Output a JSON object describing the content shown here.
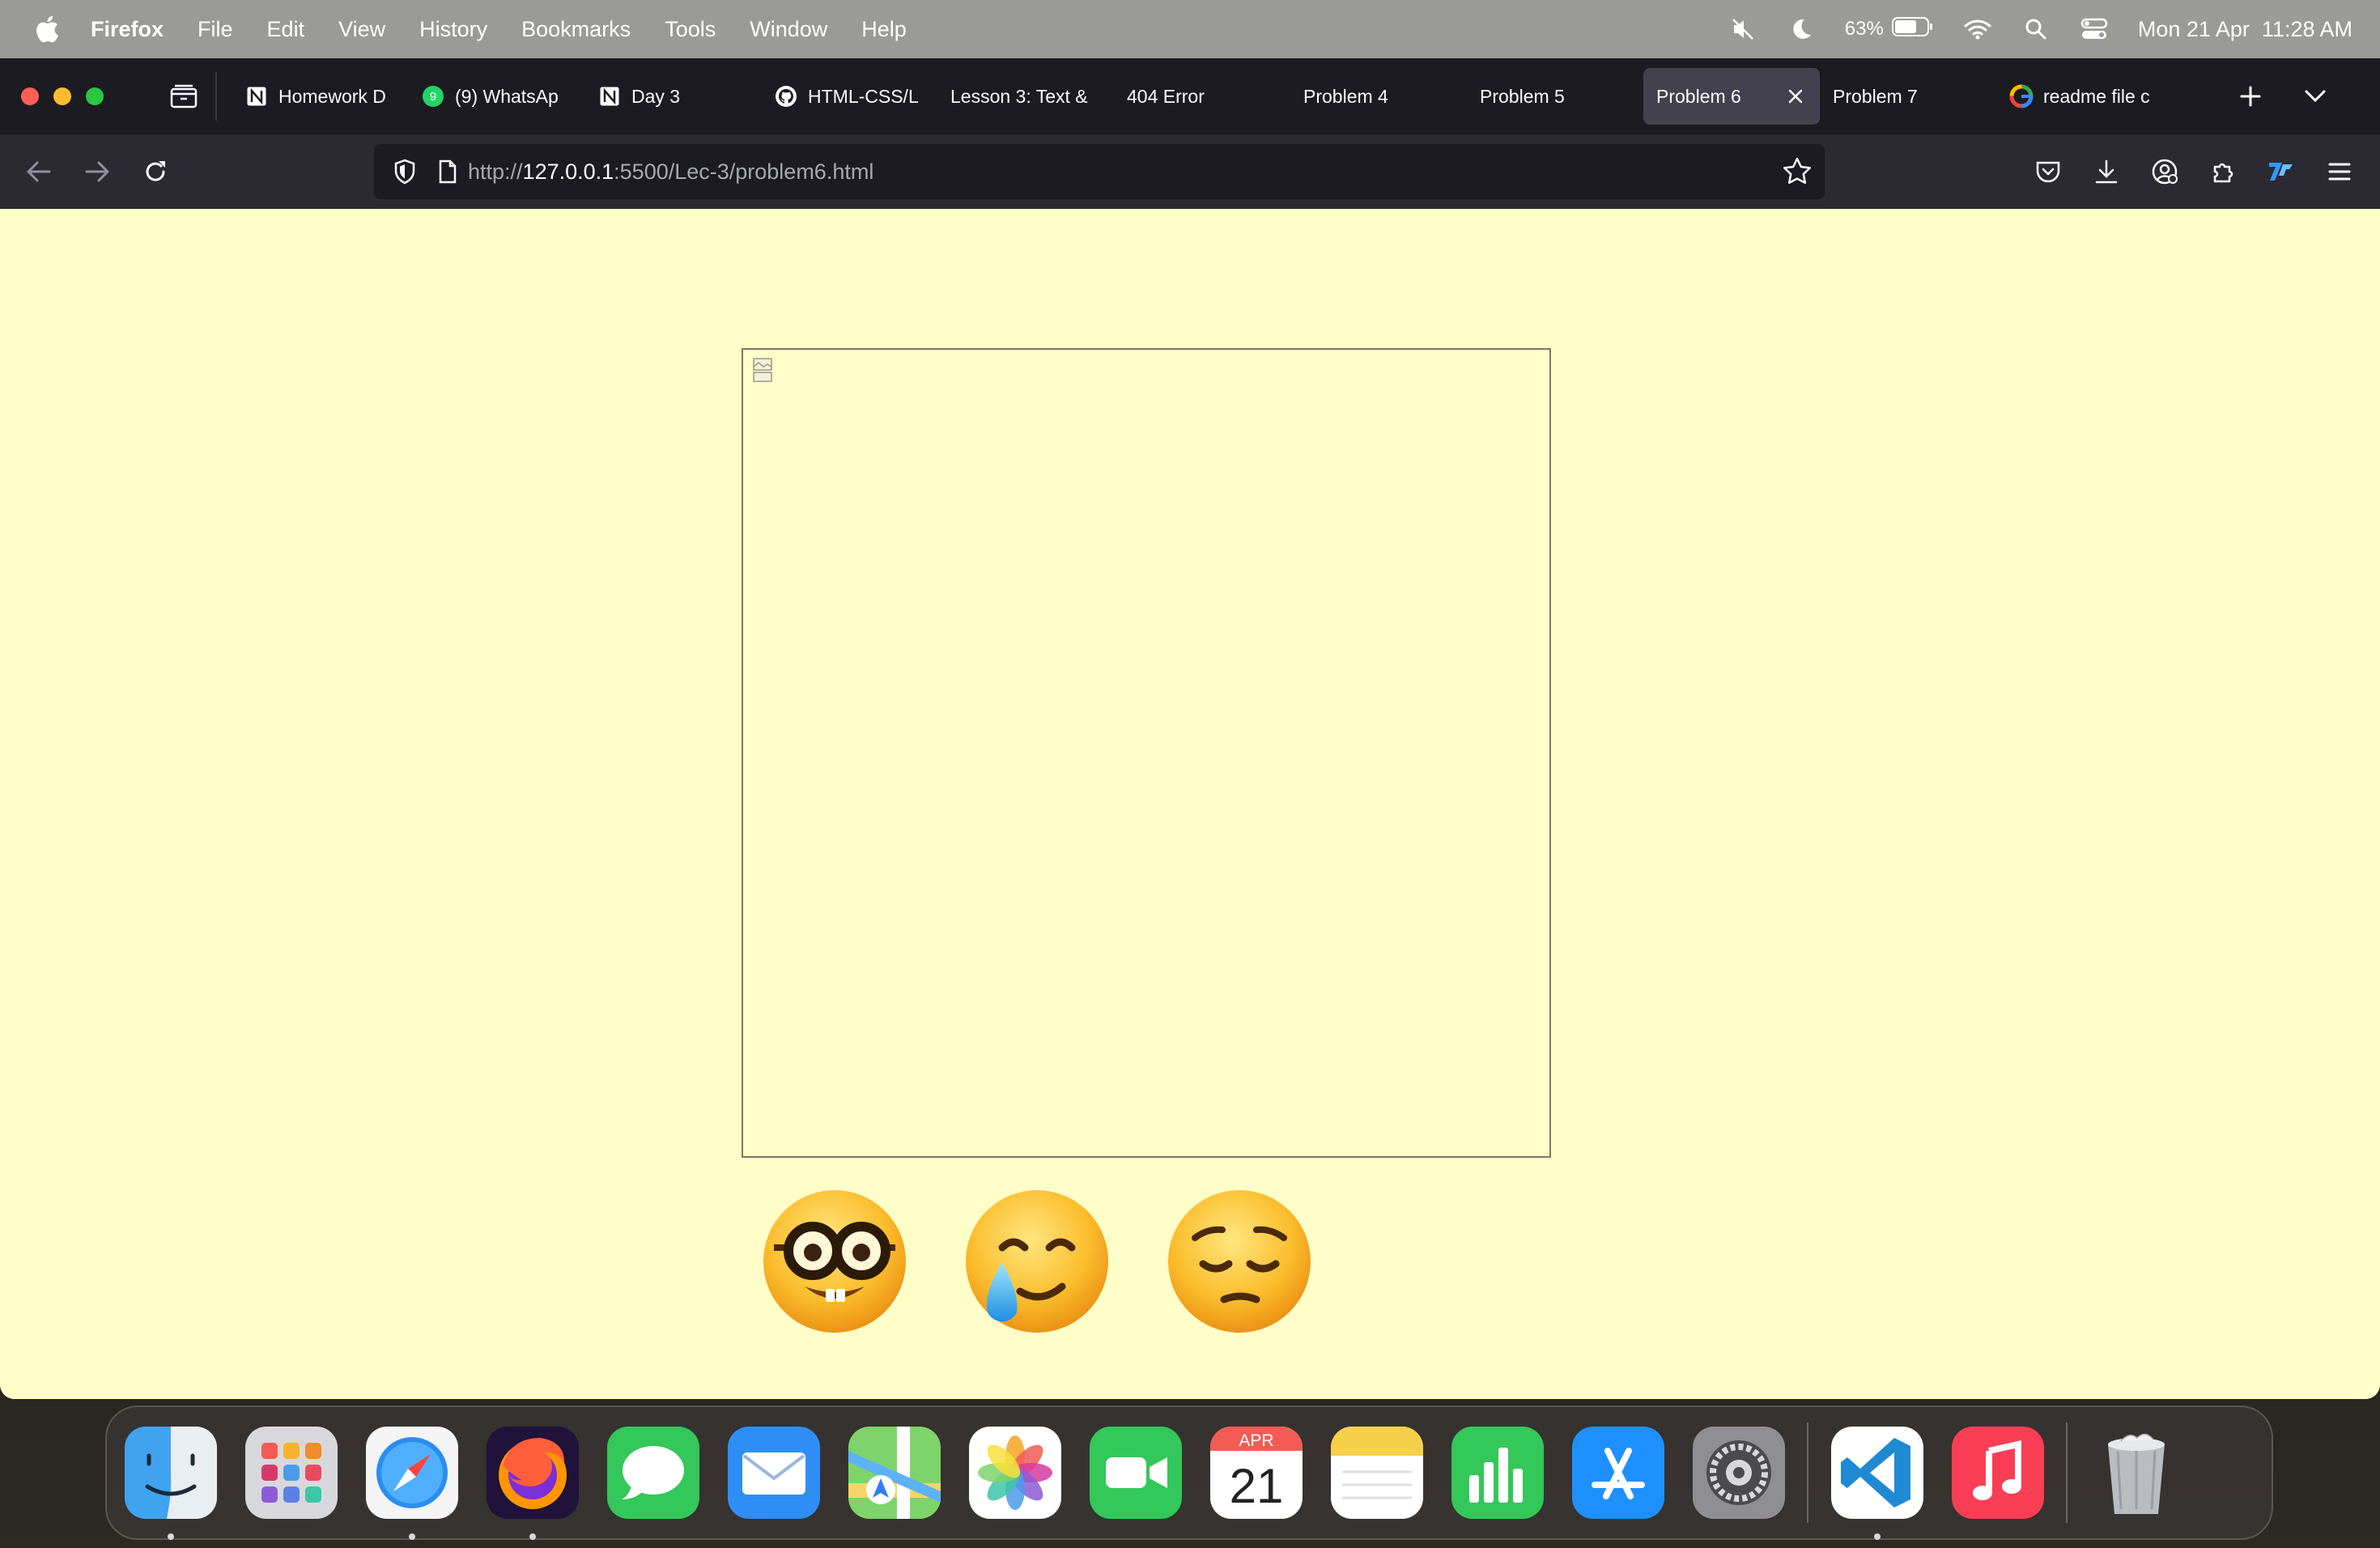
{
  "menubar": {
    "app_name": "Firefox",
    "items": [
      "File",
      "Edit",
      "View",
      "History",
      "Bookmarks",
      "Tools",
      "Window",
      "Help"
    ],
    "battery": "63%",
    "datetime": "Mon 21 Apr  11:28 AM"
  },
  "tabs": [
    {
      "label": "Homework D",
      "favicon": "notion-icon"
    },
    {
      "label": "(9) WhatsAp",
      "favicon": "whatsapp-icon",
      "badge": "9"
    },
    {
      "label": "Day 3",
      "favicon": "notion-icon"
    },
    {
      "label": "HTML-CSS/L",
      "favicon": "github-icon"
    },
    {
      "label": "Lesson 3: Text &",
      "favicon": ""
    },
    {
      "label": "404 Error",
      "favicon": ""
    },
    {
      "label": "Problem 4",
      "favicon": ""
    },
    {
      "label": "Problem 5",
      "favicon": ""
    },
    {
      "label": "Problem 6",
      "favicon": "",
      "active": true
    },
    {
      "label": "Problem 7",
      "favicon": ""
    },
    {
      "label": "readme file c",
      "favicon": "google-icon"
    }
  ],
  "urlbar": {
    "scheme": "http://",
    "host": "127.0.0.1",
    "rest": ":5500/Lec-3/problem6.html"
  },
  "emojis": [
    "nerd-face",
    "smiling-face-with-tear",
    "pensive-face"
  ],
  "calendar": {
    "month": "APR",
    "day": "21"
  },
  "colors": {
    "page_background": "#fffdc8",
    "tabbar": "#1c1b22",
    "navbar": "#2b2a33",
    "active_tab": "#42414d"
  }
}
